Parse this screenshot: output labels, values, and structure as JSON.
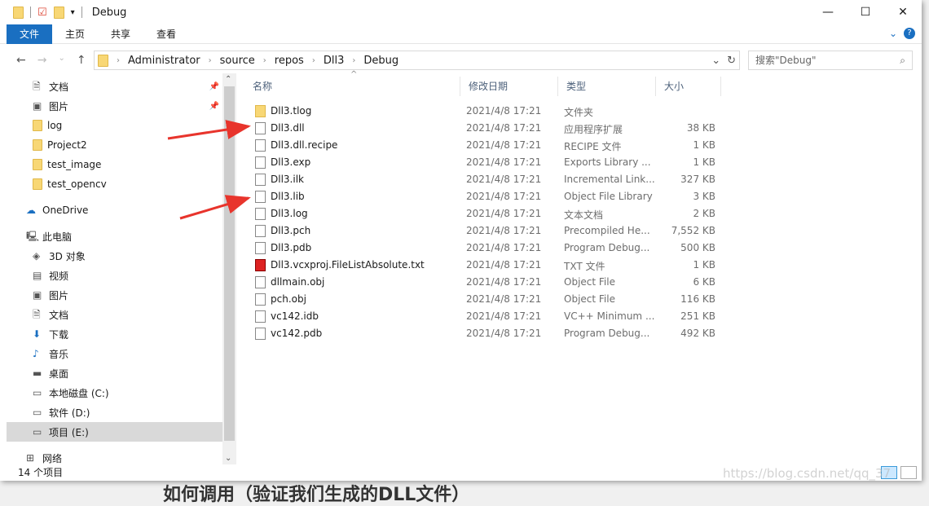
{
  "window": {
    "title": "Debug",
    "controls": [
      "—",
      "☐",
      "✕"
    ]
  },
  "ribbon": {
    "tabs": [
      "文件",
      "主页",
      "共享",
      "查看"
    ],
    "help": "?"
  },
  "address": {
    "path": [
      "Administrator",
      "source",
      "repos",
      "Dll3",
      "Debug"
    ],
    "search_placeholder": "搜索\"Debug\""
  },
  "nav": [
    {
      "label": "文档",
      "icon": "document-icon",
      "pinned": true
    },
    {
      "label": "图片",
      "icon": "picture-icon",
      "pinned": true
    },
    {
      "label": "log",
      "icon": "folder-icon"
    },
    {
      "label": "Project2",
      "icon": "folder-icon"
    },
    {
      "label": "test_image",
      "icon": "folder-icon"
    },
    {
      "label": "test_opencv",
      "icon": "folder-icon"
    },
    {
      "label": "OneDrive",
      "icon": "cloud-icon"
    },
    {
      "label": "此电脑",
      "icon": "computer-icon"
    },
    {
      "label": "3D 对象",
      "icon": "3d-icon"
    },
    {
      "label": "视频",
      "icon": "video-icon"
    },
    {
      "label": "图片",
      "icon": "picture-icon"
    },
    {
      "label": "文档",
      "icon": "document-icon"
    },
    {
      "label": "下载",
      "icon": "download-icon"
    },
    {
      "label": "音乐",
      "icon": "music-icon"
    },
    {
      "label": "桌面",
      "icon": "desktop-icon"
    },
    {
      "label": "本地磁盘 (C:)",
      "icon": "drive-icon"
    },
    {
      "label": "软件 (D:)",
      "icon": "drive-icon"
    },
    {
      "label": "项目 (E:)",
      "icon": "drive-icon",
      "selected": true
    },
    {
      "label": "网络",
      "icon": "network-icon"
    }
  ],
  "columns": [
    "名称",
    "修改日期",
    "类型",
    "大小"
  ],
  "files": [
    {
      "name": "Dll3.tlog",
      "date": "2021/4/8 17:21",
      "type": "文件夹",
      "size": "",
      "kind": "folder"
    },
    {
      "name": "Dll3.dll",
      "date": "2021/4/8 17:21",
      "type": "应用程序扩展",
      "size": "38 KB",
      "kind": "file"
    },
    {
      "name": "Dll3.dll.recipe",
      "date": "2021/4/8 17:21",
      "type": "RECIPE 文件",
      "size": "1 KB",
      "kind": "file"
    },
    {
      "name": "Dll3.exp",
      "date": "2021/4/8 17:21",
      "type": "Exports Library ...",
      "size": "1 KB",
      "kind": "file"
    },
    {
      "name": "Dll3.ilk",
      "date": "2021/4/8 17:21",
      "type": "Incremental Link...",
      "size": "327 KB",
      "kind": "file"
    },
    {
      "name": "Dll3.lib",
      "date": "2021/4/8 17:21",
      "type": "Object File Library",
      "size": "3 KB",
      "kind": "file"
    },
    {
      "name": "Dll3.log",
      "date": "2021/4/8 17:21",
      "type": "文本文档",
      "size": "2 KB",
      "kind": "file"
    },
    {
      "name": "Dll3.pch",
      "date": "2021/4/8 17:21",
      "type": "Precompiled He...",
      "size": "7,552 KB",
      "kind": "file"
    },
    {
      "name": "Dll3.pdb",
      "date": "2021/4/8 17:21",
      "type": "Program Debug...",
      "size": "500 KB",
      "kind": "file"
    },
    {
      "name": "Dll3.vcxproj.FileListAbsolute.txt",
      "date": "2021/4/8 17:21",
      "type": "TXT 文件",
      "size": "1 KB",
      "kind": "txt"
    },
    {
      "name": "dllmain.obj",
      "date": "2021/4/8 17:21",
      "type": "Object File",
      "size": "6 KB",
      "kind": "file"
    },
    {
      "name": "pch.obj",
      "date": "2021/4/8 17:21",
      "type": "Object File",
      "size": "116 KB",
      "kind": "file"
    },
    {
      "name": "vc142.idb",
      "date": "2021/4/8 17:21",
      "type": "VC++ Minimum ...",
      "size": "251 KB",
      "kind": "file"
    },
    {
      "name": "vc142.pdb",
      "date": "2021/4/8 17:21",
      "type": "Program Debug...",
      "size": "492 KB",
      "kind": "file"
    }
  ],
  "status": {
    "count": "14 个项目"
  },
  "watermark": "https://blog.csdn.net/qq_37",
  "background_text": "如何调用（验证我们生成的DLL文件）",
  "colors": {
    "accent": "#1a6fc1",
    "arrow": "#e8342c",
    "selection": "#d9d9d9"
  }
}
